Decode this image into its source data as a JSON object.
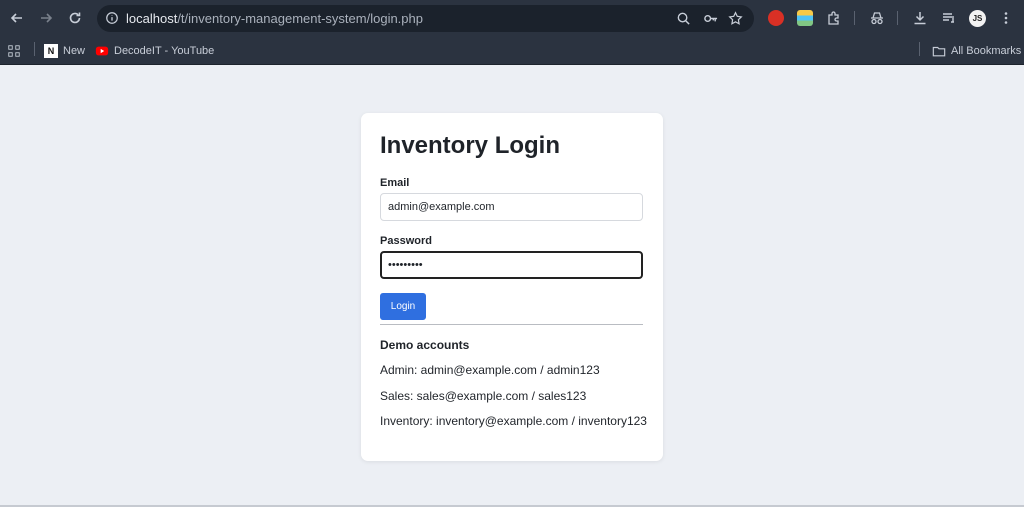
{
  "browser": {
    "url_host": "localhost",
    "url_path": "/t/inventory-management-system/login.php",
    "bookmarks": [
      {
        "label": "New",
        "icon": "notion-icon"
      },
      {
        "label": "DecodeIT - YouTube",
        "icon": "youtube-icon"
      }
    ],
    "all_bookmarks_label": "All Bookmarks",
    "profile_initials": "JS"
  },
  "login": {
    "title": "Inventory Login",
    "email_label": "Email",
    "email_value": "admin@example.com",
    "password_label": "Password",
    "password_value": "•••••••••",
    "button_label": "Login"
  },
  "demo": {
    "title": "Demo accounts",
    "accounts": [
      "Admin: admin@example.com / admin123",
      "Sales: sales@example.com / sales123",
      "Inventory: inventory@example.com / inventory123"
    ]
  },
  "colors": {
    "primary_button": "#2f6fe0",
    "page_background": "#eceff4",
    "chrome_background": "#2b3340"
  }
}
